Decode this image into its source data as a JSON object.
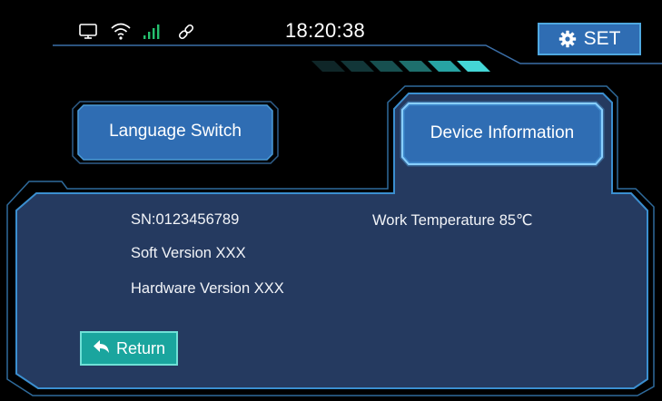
{
  "status_bar": {
    "icons": [
      "monitor-icon",
      "wifi-icon",
      "signal-icon",
      "link-icon"
    ],
    "time": "18:20:38"
  },
  "header": {
    "set_label": "SET",
    "set_icon": "gear-icon"
  },
  "tabs": [
    {
      "label": "Language Switch",
      "active": false
    },
    {
      "label": "Device Information",
      "active": true
    }
  ],
  "device_info": {
    "sn": "SN:0123456789",
    "soft_version": "Soft Version XXX",
    "hardware_version": "Hardware Version XXX",
    "work_temperature": "Work Temperature 85℃"
  },
  "return_button": {
    "label": "Return",
    "icon": "reply-arrow-icon"
  },
  "colors": {
    "background": "#000000",
    "panel": "#253a60",
    "panel_border": "#3b8fd0",
    "button_blue": "#2f6db3",
    "return_teal": "#1aa59e",
    "accent_cyan": "#2ec9d0"
  }
}
